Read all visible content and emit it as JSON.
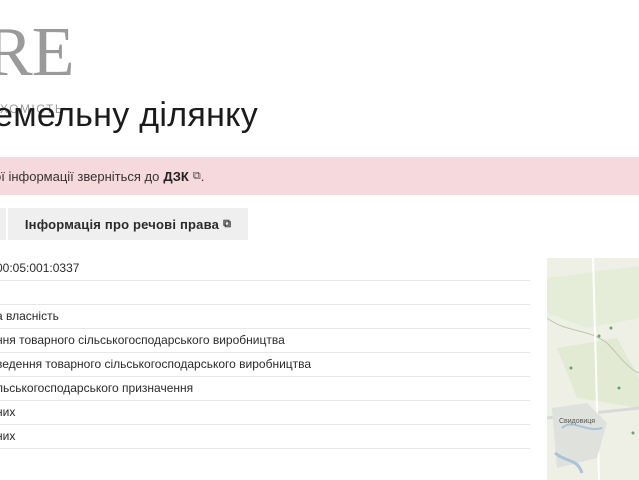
{
  "logo": {
    "letters": "RE",
    "subtitle": "ХОМІСТЬ"
  },
  "page": {
    "title": "емельну ділянку"
  },
  "alert": {
    "text": "ої інформації зверніться до",
    "link": "ДЗК",
    "suffix": "."
  },
  "tabs": {
    "rights_info": "Інформація про речові права"
  },
  "rows": [
    "00:05:001:0337",
    "",
    "а власність",
    "ння товарного сільськогосподарського виробництва",
    "ведення товарного сільськогосподарського виробництва",
    "льськогосподарського призначення",
    "них",
    "них"
  ],
  "map": {
    "place_label": "Свидовиця"
  }
}
